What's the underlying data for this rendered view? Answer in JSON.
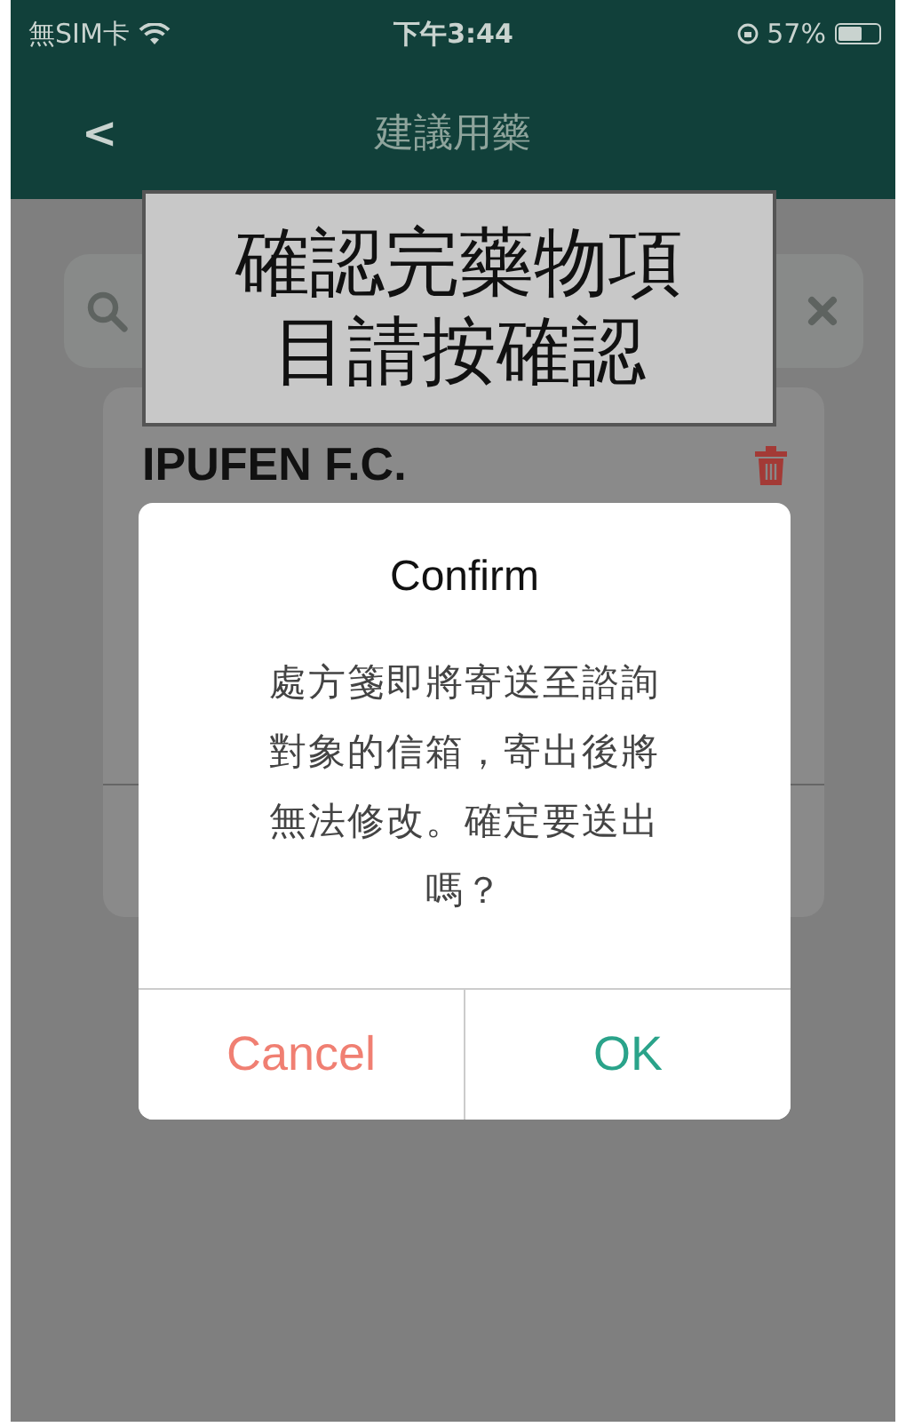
{
  "status_bar": {
    "carrier": "無SIM卡",
    "time": "下午3:44",
    "battery": "57%"
  },
  "nav": {
    "back": "<",
    "title": "建議用藥"
  },
  "medications": [
    {
      "name": "IPUFEN F.C."
    }
  ],
  "caption": {
    "text": "確認完藥物項目請按確認"
  },
  "dialog": {
    "title": "Confirm",
    "message": "處方箋即將寄送至諮詢對象的信箱，寄出後將無法修改。確定要送出嗎？",
    "buttons": [
      {
        "label": "Cancel",
        "kind": "cancel"
      },
      {
        "label": "OK",
        "kind": "ok"
      }
    ]
  }
}
